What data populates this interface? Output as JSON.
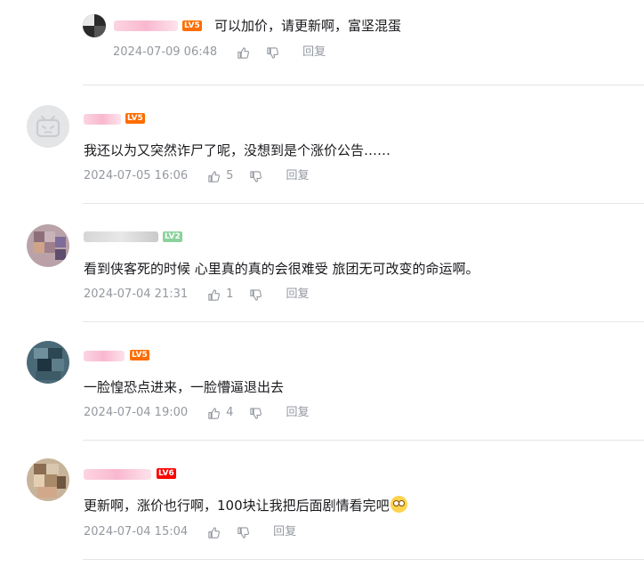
{
  "comments": [
    {
      "user_level": "LV5",
      "text": "可以加价，请更新啊，富坚混蛋",
      "date": "2024-07-09 06:48",
      "likes": "",
      "reply_label": "回复"
    },
    {
      "user_level": "LV5",
      "text": "我还以为又突然诈尸了呢，没想到是个涨价公告……",
      "date": "2024-07-05 16:06",
      "likes": "5",
      "reply_label": "回复"
    },
    {
      "user_level": "LV2",
      "text": "看到侠客死的时候 心里真的真的会很难受 旅团无可改变的命运啊。",
      "date": "2024-07-04 21:31",
      "likes": "1",
      "reply_label": "回复"
    },
    {
      "user_level": "LV5",
      "text": "一脸惶恐点进来，一脸懵逼退出去",
      "date": "2024-07-04 19:00",
      "likes": "4",
      "reply_label": "回复"
    },
    {
      "user_level": "LV6",
      "text": "更新啊，涨价也行啊，100块让我把后面剧情看完吧",
      "date": "2024-07-04 15:04",
      "likes": "",
      "reply_label": "回复"
    }
  ],
  "icons": {
    "like": "thumb-up-icon",
    "dislike": "thumb-down-icon",
    "emoji": "dizzy-face-emoji-icon",
    "default_avatar": "bilibili-tv-icon"
  },
  "colors": {
    "lv5": "#ff6c00",
    "lv2": "#8bd29b",
    "lv6": "#ff0000",
    "meta": "#9499a0",
    "divider": "#e3e5e7"
  }
}
